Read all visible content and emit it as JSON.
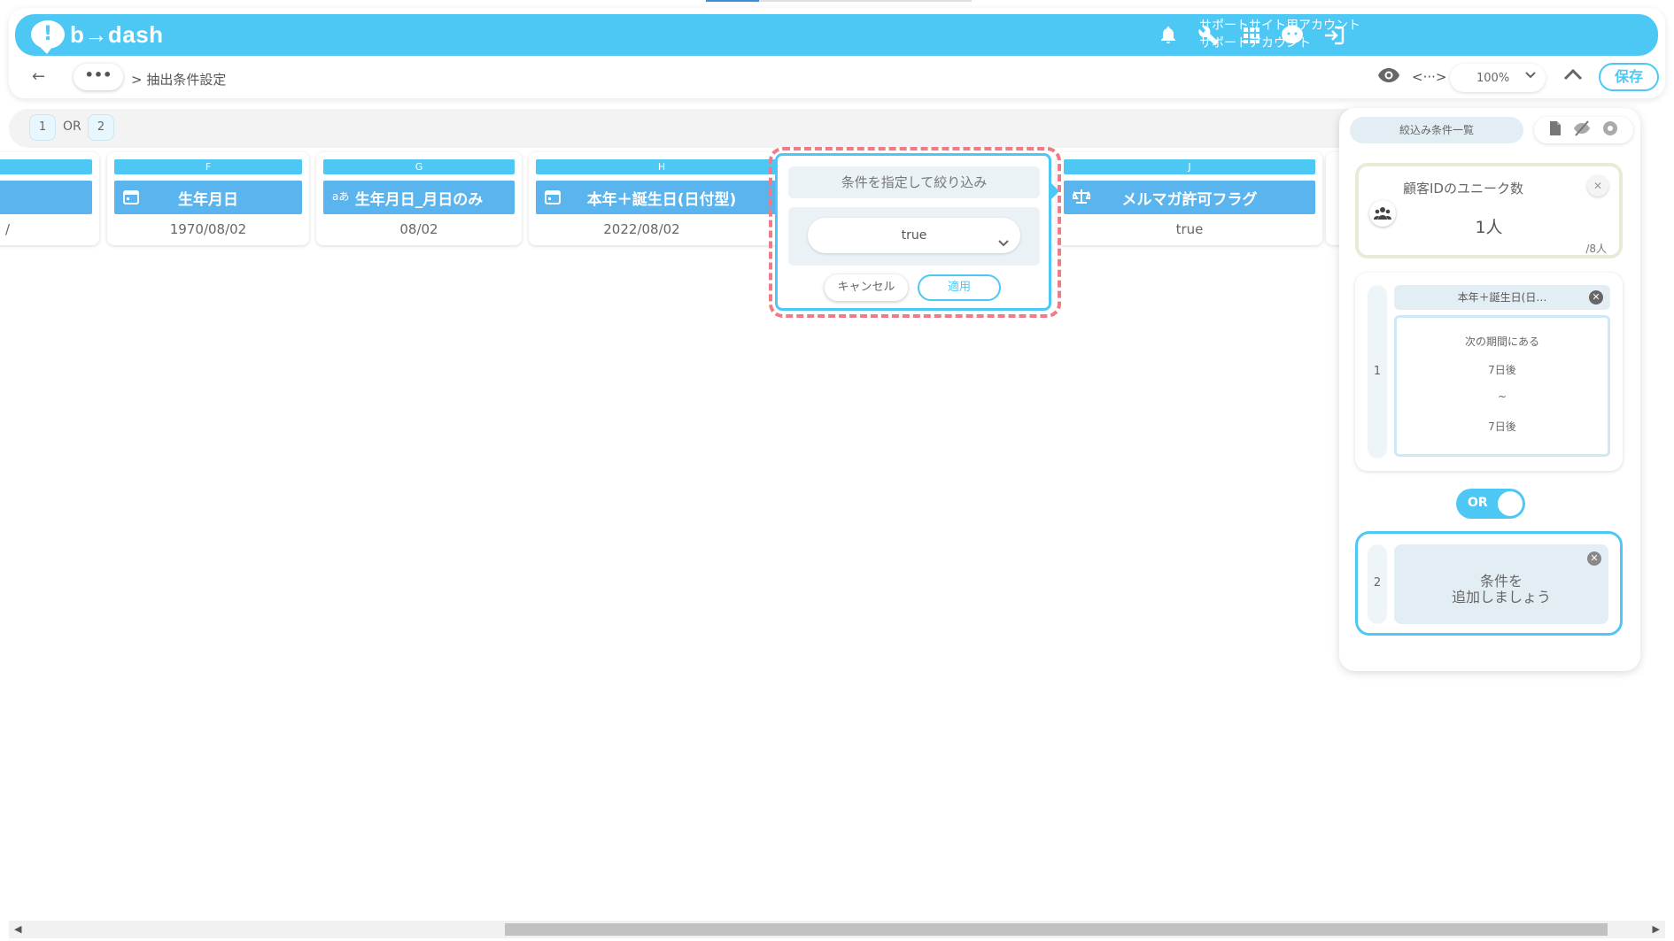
{
  "header": {
    "logo_mark": "!",
    "logo_text": "b→dash",
    "account_line1": "サポートサイト用アカウント",
    "account_line2": "サポートアカウント",
    "icons": [
      "bell-icon",
      "wrench-icon",
      "grid-icon",
      "support-icon",
      "logout-icon"
    ]
  },
  "breadcrumb": {
    "back": "←",
    "more": "•••",
    "path": "> 抽出条件設定"
  },
  "toolbar": {
    "code_icon": "<···>",
    "zoom": "100%",
    "save_label": "保存"
  },
  "groups": {
    "first": "1",
    "operator": "OR",
    "second": "2"
  },
  "columns": [
    {
      "letter": "",
      "name": "",
      "value": "/"
    },
    {
      "letter": "F",
      "name": "生年月日",
      "value": "1970/08/02",
      "icon": "calendar-icon"
    },
    {
      "letter": "G",
      "name": "生年月日_月日のみ",
      "value": "08/02",
      "icon": "text-type-icon",
      "icon_text": "aあ"
    },
    {
      "letter": "H",
      "name": "本年＋誕生日(日付型)",
      "value": "2022/08/02",
      "icon": "calendar-icon"
    },
    {
      "letter": "J",
      "name": "メルマガ許可フラグ",
      "value": "true",
      "icon": "scale-icon"
    }
  ],
  "popup": {
    "title": "条件を指定して絞り込み",
    "select_value": "true",
    "cancel_label": "キャンセル",
    "apply_label": "適用"
  },
  "panel": {
    "title": "絞込み条件一覧",
    "count_label": "顧客IDのユニーク数",
    "count_value": "1人",
    "count_total": "/8人",
    "condition1": {
      "number": "1",
      "column": "本年＋誕生日(日…",
      "line1": "次の期間にある",
      "line2": "7日後",
      "line3": "~",
      "line4": "7日後"
    },
    "toggle_label": "OR",
    "condition2": {
      "number": "2",
      "line1": "条件を",
      "line2": "追加しましょう"
    }
  },
  "colors": {
    "accent": "#4dc8f5",
    "column_header": "#5ab4ee",
    "highlight_dash": "#f07a86"
  }
}
